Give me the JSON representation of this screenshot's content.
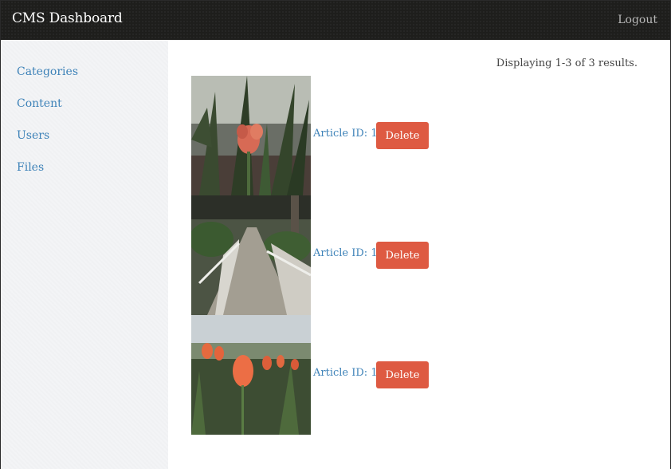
{
  "header": {
    "title": "CMS Dashboard",
    "logout_label": "Logout"
  },
  "sidebar": {
    "items": [
      {
        "label": "Categories"
      },
      {
        "label": "Content"
      },
      {
        "label": "Users"
      },
      {
        "label": "Files"
      }
    ]
  },
  "main": {
    "summary": "Displaying 1-3 of 3 results.",
    "articles": [
      {
        "link_label": "Article ID: 1",
        "delete_label": "Delete",
        "image": "tulip-closeup-photo"
      },
      {
        "link_label": "Article ID: 1",
        "delete_label": "Delete",
        "image": "garden-bridge-photo"
      },
      {
        "link_label": "Article ID: 1",
        "delete_label": "Delete",
        "image": "tulip-field-photo"
      }
    ]
  },
  "colors": {
    "topbar": "#1e1e1c",
    "sidebar": "#f3f4f6",
    "link": "#3d82b8",
    "delete_button": "#de5a42"
  }
}
